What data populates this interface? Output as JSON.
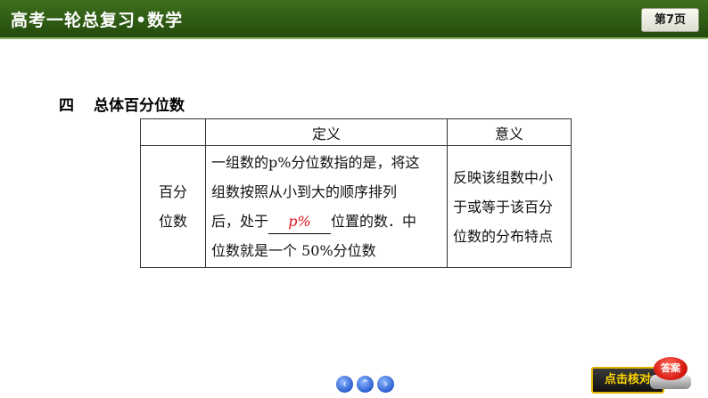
{
  "header": {
    "title": "高考一轮总复习•数学",
    "page_label": "第7页",
    "background_color": "#2f5c14"
  },
  "section": {
    "number": "四",
    "title": "总体百分位数"
  },
  "table": {
    "headers": [
      "",
      "定义",
      "意义"
    ],
    "term_lines": [
      "百分",
      "位数"
    ],
    "definition": {
      "line1": "一组数的p%分位数指的是，将这",
      "line2": "组数按照从小到大的顺序排列",
      "line3_prefix": "后，处于",
      "blank_answer": "p%",
      "line3_suffix": "位置的数．中",
      "line4": "位数就是一个 50%分位数"
    },
    "meaning_lines": [
      "反映该组数中小",
      "于或等于该百分",
      "位数的分布特点"
    ],
    "answer_color": "#e0101a"
  },
  "footer": {
    "nav_icons": [
      "prev-icon",
      "home-icon",
      "next-icon"
    ],
    "nav_glyphs": {
      "prev": "‹",
      "home": "⌃",
      "next": "›"
    },
    "check_label": "点击核对",
    "answer_label": "答案"
  }
}
